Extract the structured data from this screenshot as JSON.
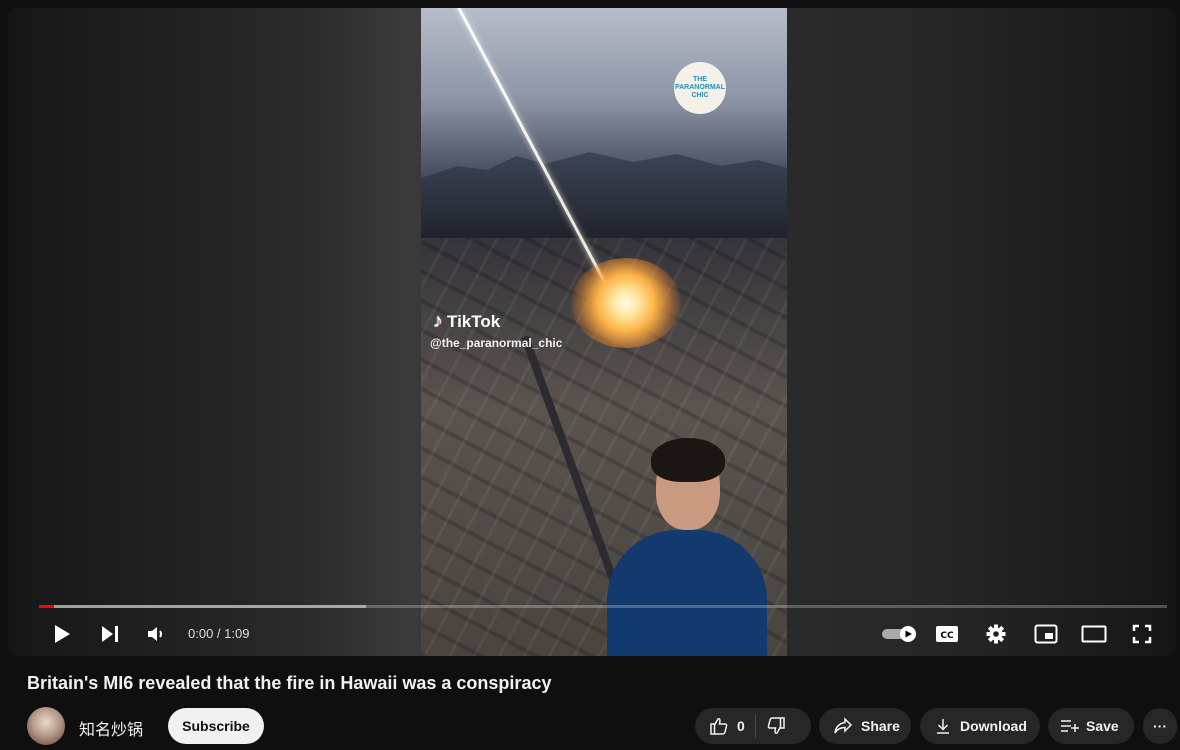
{
  "video": {
    "watermark_text": "THE PARANORMAL CHIC",
    "tiktok_label": "TikTok",
    "tiktok_handle": "@the_paranormal_chic"
  },
  "player": {
    "time_display": "0:00 / 1:09",
    "progress_played_fraction": 0.013,
    "progress_buffered_fraction": 0.29,
    "progress_color": "#ff0000",
    "controls": [
      "play-icon",
      "next-icon",
      "volume-icon",
      "autoplay-toggle",
      "captions-icon",
      "settings-icon",
      "miniplayer-icon",
      "theater-icon",
      "fullscreen-icon"
    ]
  },
  "title": "Britain's MI6 revealed that the fire in Hawaii was a conspiracy",
  "channel": {
    "name": "知名炒锅",
    "subscribe_label": "Subscribe"
  },
  "actions": {
    "like_count": "0",
    "share_label": "Share",
    "download_label": "Download",
    "save_label": "Save",
    "more_label": "···"
  }
}
